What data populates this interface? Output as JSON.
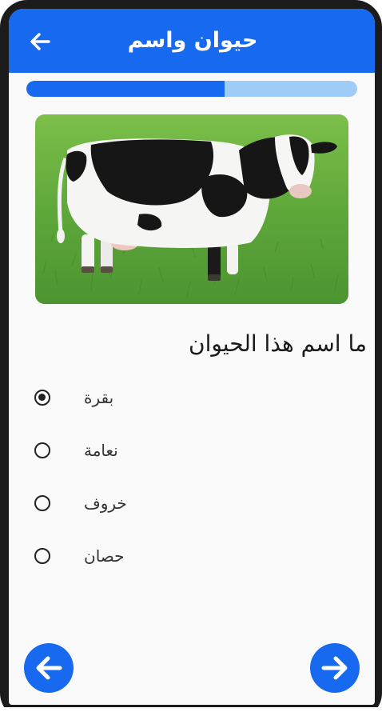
{
  "app_bar": {
    "title": "حيوان واسم",
    "back_icon": "arrow-left-icon",
    "color": "#1769f0"
  },
  "progress": {
    "value": 0.6,
    "fill_color": "#1769f0",
    "track_color": "#9fcdf8"
  },
  "question": {
    "image": "cow-photo",
    "text": "ما اسم هذا الحيوان"
  },
  "options": [
    {
      "label": "بقرة",
      "selected": true
    },
    {
      "label": "نعامة",
      "selected": false
    },
    {
      "label": "خروف",
      "selected": false
    },
    {
      "label": "حصان",
      "selected": false
    }
  ],
  "navigation": {
    "previous_icon": "arrow-left-icon",
    "next_icon": "arrow-right-icon"
  }
}
